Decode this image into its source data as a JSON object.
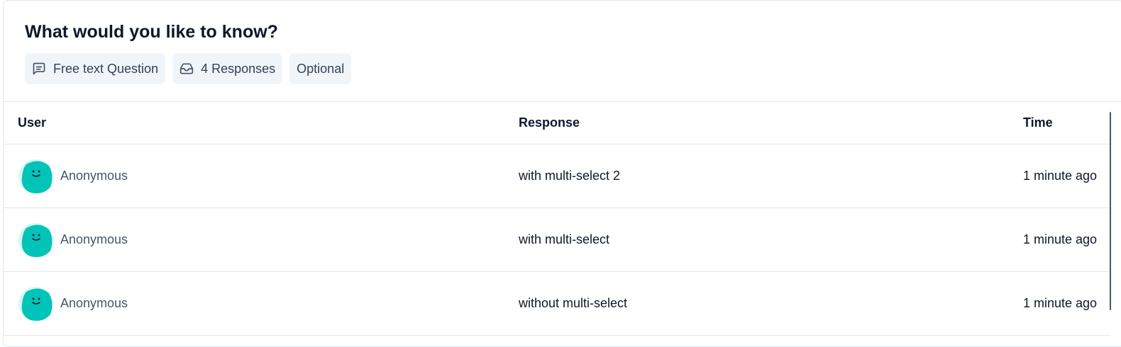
{
  "question": {
    "title": "What would you like to know?",
    "chips": [
      {
        "icon": "message-square-icon",
        "label": "Free text Question"
      },
      {
        "icon": "inbox-icon",
        "label": "4 Responses"
      },
      {
        "label": "Optional"
      }
    ]
  },
  "table": {
    "columns": [
      "User",
      "Response",
      "Time"
    ],
    "rows": [
      {
        "user": "Anonymous",
        "response": "with multi-select 2",
        "time": "1 minute ago"
      },
      {
        "user": "Anonymous",
        "response": "with multi-select",
        "time": "1 minute ago"
      },
      {
        "user": "Anonymous",
        "response": "without multi-select",
        "time": "1 minute ago"
      }
    ]
  },
  "colors": {
    "avatar": "#00c4b8",
    "avatar_light": "#d6f7f4",
    "chip_bg": "#f1f5f9"
  }
}
